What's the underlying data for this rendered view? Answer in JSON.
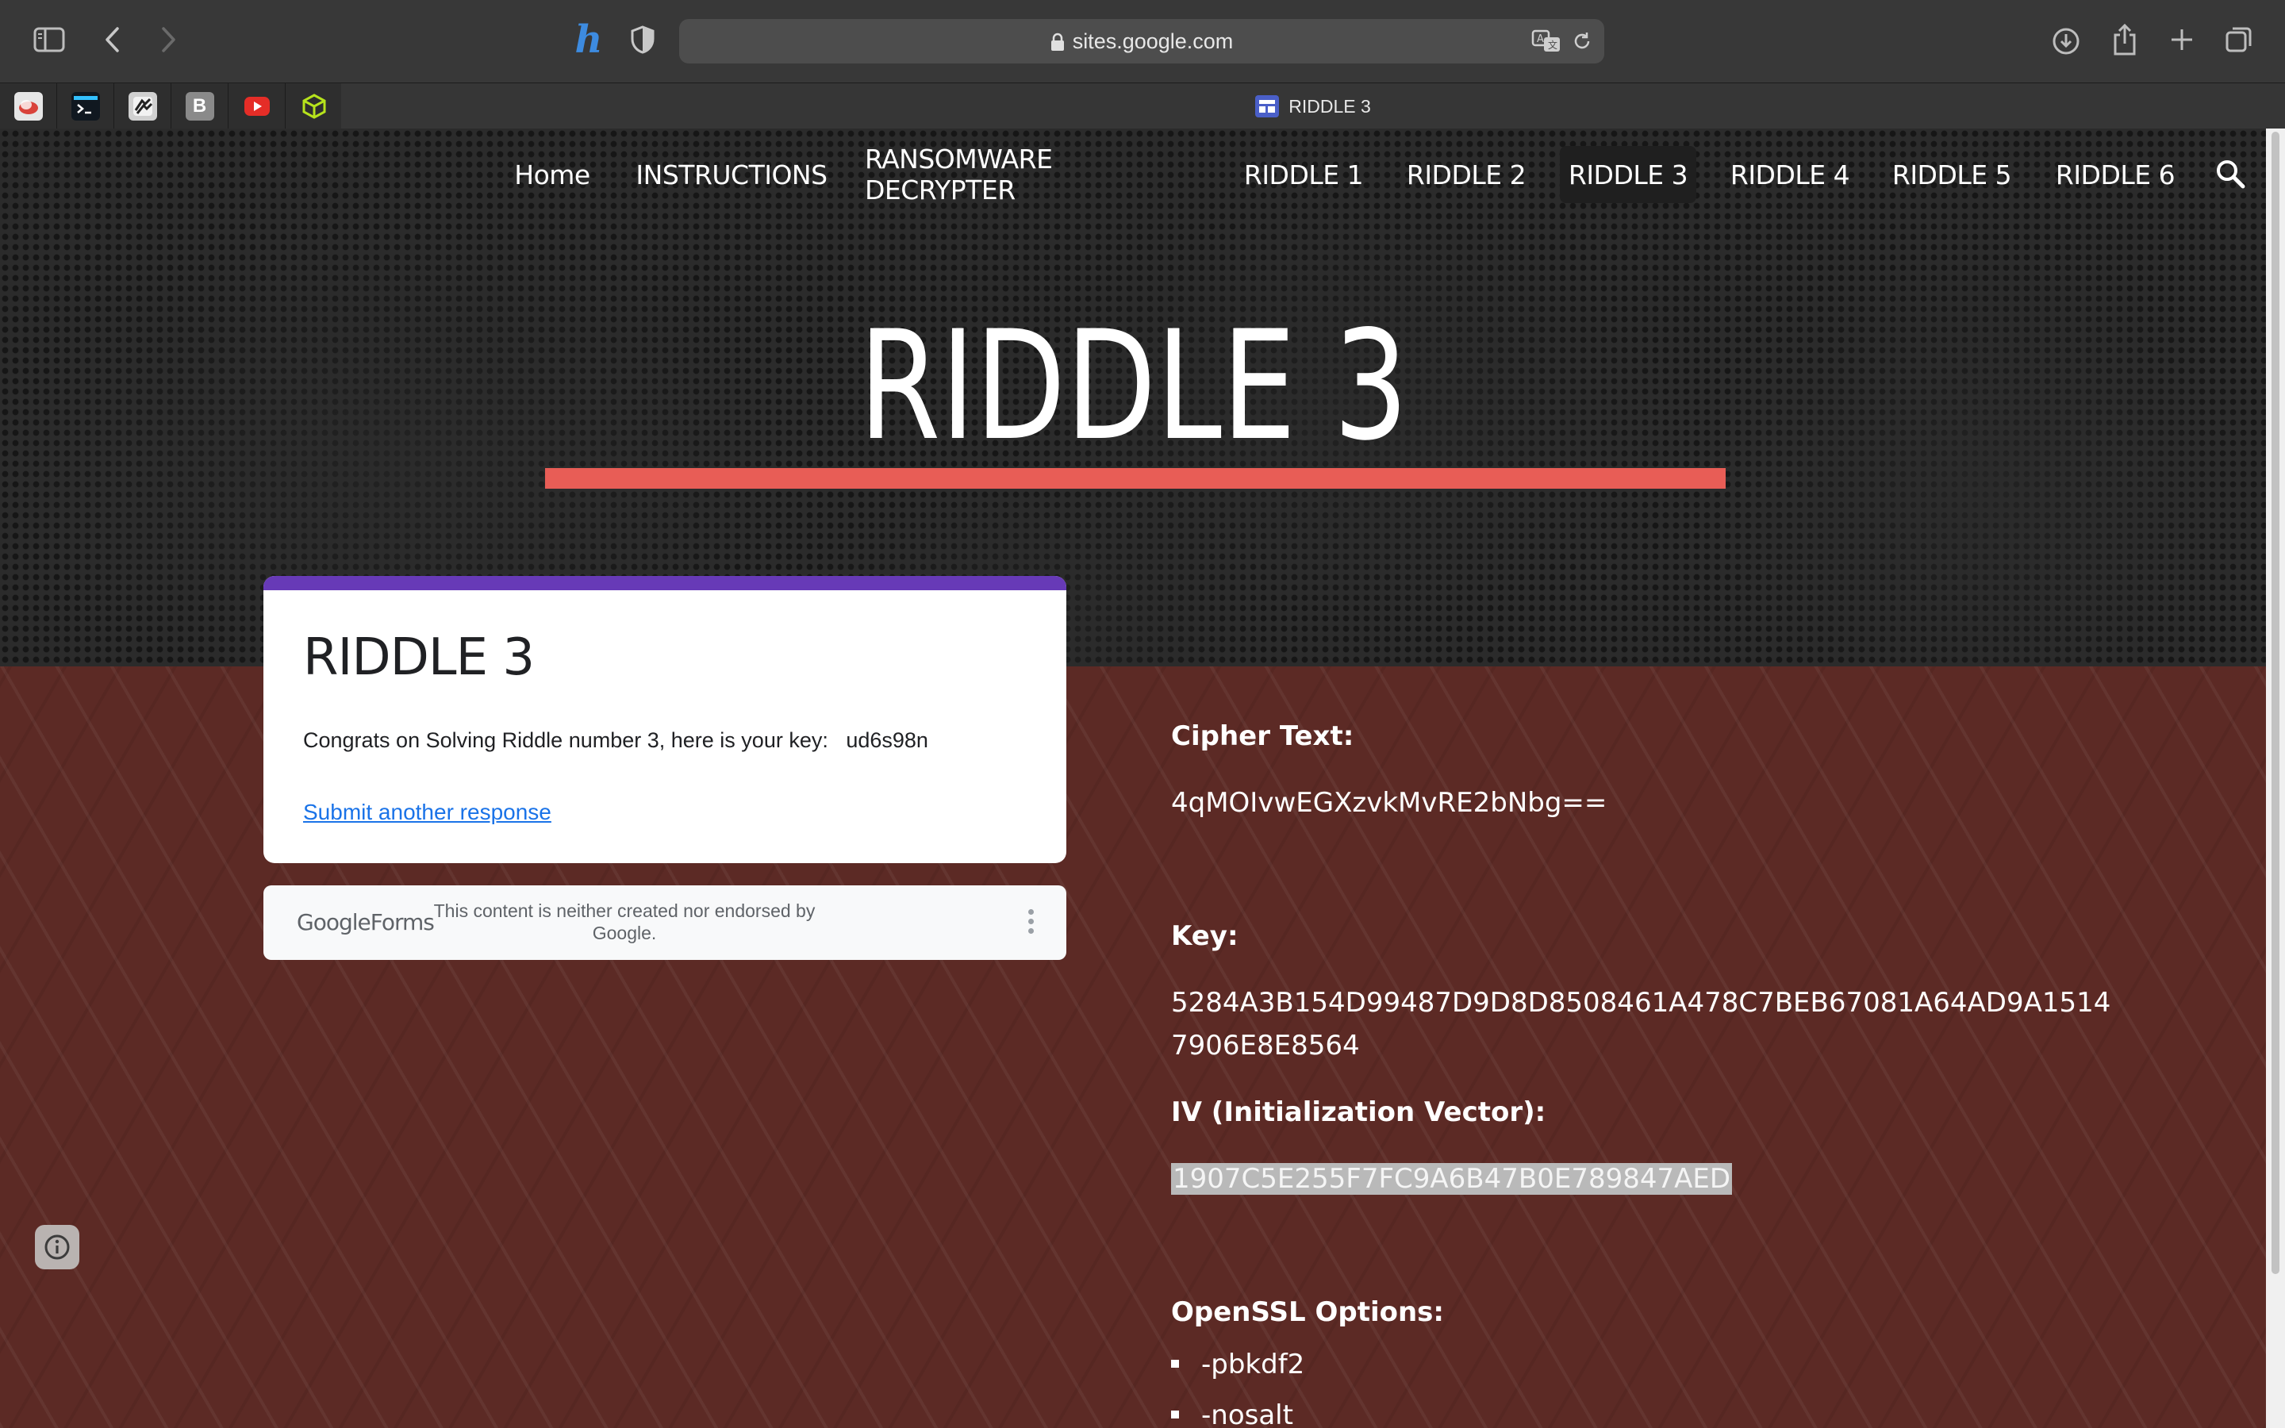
{
  "browser": {
    "address": "sites.google.com",
    "active_tab_title": "RIDDLE 3",
    "pinned_tabs": [
      {
        "icon": "cloud-app-icon",
        "letter": "",
        "color": "#d8d8d8"
      },
      {
        "icon": "terminal-icon",
        "letter": "",
        "color": "#1e3a5f"
      },
      {
        "icon": "zebra-icon",
        "letter": "",
        "color": "#cfcfcf"
      },
      {
        "icon": "b-letter-icon",
        "letter": "B",
        "color": "#8a8a8a"
      },
      {
        "icon": "youtube-icon",
        "letter": "",
        "color": "#e52d27"
      },
      {
        "icon": "cube-icon",
        "letter": "",
        "color": "#b6e31c"
      }
    ]
  },
  "nav": {
    "items": [
      "Home",
      "INSTRUCTIONS",
      "RANSOMWARE DECRYPTER",
      "RIDDLE 1",
      "RIDDLE 2",
      "RIDDLE 3",
      "RIDDLE 4",
      "RIDDLE 5",
      "RIDDLE 6"
    ],
    "active": "RIDDLE 3"
  },
  "hero": {
    "title": "RIDDLE 3",
    "accent_color": "#e85d56"
  },
  "form": {
    "title": "RIDDLE 3",
    "message": "Congrats on Solving Riddle number 3, here is your key:   ud6s98n",
    "link": "Submit another response",
    "footer_brand": "GoogleForms",
    "footer_note": "This content is neither created nor endorsed by Google.",
    "accent_color": "#673ab7"
  },
  "details": {
    "cipher_label": "Cipher Text:",
    "cipher_value": "4qMOIvwEGXzvkMvRE2bNbg==",
    "key_label": "Key:",
    "key_line1": "5284A3B154D99487D9D8D8508461A478C7BEB67081A64AD9A1514",
    "key_line2": "7906E8E8564",
    "iv_label": "IV (Initialization Vector):",
    "iv_value": "1907C5E255F7FC9A6B47B0E789847AED",
    "openssl_label": "OpenSSL Options:",
    "openssl_options": [
      "-pbkdf2",
      "-nosalt"
    ]
  }
}
